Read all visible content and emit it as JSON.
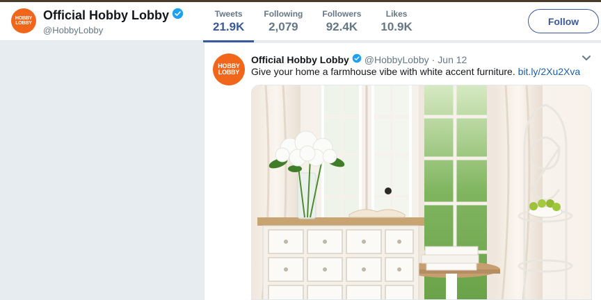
{
  "profile": {
    "name": "Official Hobby Lobby",
    "handle": "@HobbyLobby",
    "logo_line1": "HOBBY",
    "logo_line2": "LOBBY"
  },
  "stats": [
    {
      "label": "Tweets",
      "value": "21.9K"
    },
    {
      "label": "Following",
      "value": "2,079"
    },
    {
      "label": "Followers",
      "value": "92.4K"
    },
    {
      "label": "Likes",
      "value": "10.9K"
    }
  ],
  "follow_label": "Follow",
  "tweet": {
    "name": "Official Hobby Lobby",
    "handle": "@HobbyLobby",
    "dot": "·",
    "date": "Jun 12",
    "text": "Give your home a farmhouse vibe with white accent furniture.",
    "link": "bit.ly/2Xu2Xva"
  },
  "colors": {
    "brand": "#f2661b",
    "accent": "#3b5998",
    "verified": "#1da1f2",
    "link": "#1b5eab"
  }
}
